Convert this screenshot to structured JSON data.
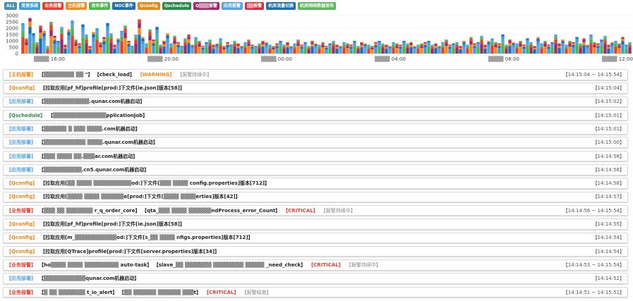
{
  "filters": [
    {
      "label": "ALL",
      "color": "#4a8fb5"
    },
    {
      "label": "变更系统",
      "color": "#3a9ee0"
    },
    {
      "label": "业务报警",
      "color": "#e8402f"
    },
    {
      "label": "主机报警",
      "color": "#f28b1e"
    },
    {
      "label": "发布事件",
      "color": "#4cb84c"
    },
    {
      "label": "NOC事件",
      "color": "#1d6fb5"
    },
    {
      "label": "Qconfig",
      "color": "#e58a16"
    },
    {
      "label": "Qschedule",
      "color": "#2e8a4a"
    },
    {
      "label": "Q▒▒▒报警",
      "color": "#9e2a6a"
    },
    {
      "label": "应用报警",
      "color": "#58a4e0"
    },
    {
      "label": "▒▒报警",
      "color": "#d62e3a"
    },
    {
      "label": "机房流量切换",
      "color": "#1f6db0"
    },
    {
      "label": "机房网络数据发布",
      "color": "#5cb85c"
    }
  ],
  "chart_data": {
    "type": "bar",
    "stacked": true,
    "yticks": [
      "3000",
      "2500",
      "2000",
      "1500",
      "1000",
      "500",
      "0"
    ],
    "ylim": [
      0,
      3000
    ],
    "xticks": [
      "▒▒▒▒ 16:00",
      "▒▒▒▒ 20:00",
      "▒▒▒▒ 00:00",
      "▒▒▒▒ 04:00",
      "▒▒▒▒ 08:00",
      "▒▒▒▒ 12:00"
    ],
    "colors": [
      "#e8402f",
      "#f28b1e",
      "#3a9ee0",
      "#4cb84c",
      "#9e2a6a",
      "#1d6fb5",
      "#58a4e0"
    ],
    "series_totals": [
      2400,
      1200,
      2800,
      1600,
      900,
      2200,
      1800,
      600,
      2500,
      1400,
      1000,
      2100,
      700,
      1900,
      2600,
      1100,
      800,
      2300,
      1500,
      600,
      1700,
      2000,
      900,
      1300,
      2400,
      1600,
      700,
      1200,
      1800,
      2200,
      1000,
      600,
      1500,
      2700,
      1300,
      800,
      1900,
      1100,
      2100,
      700,
      1000,
      1600,
      800,
      1400,
      900,
      600,
      1200,
      1500,
      700,
      1300,
      1000,
      600,
      900,
      1100,
      700,
      800,
      1200,
      600,
      900,
      700,
      1000,
      800,
      600,
      900,
      1100,
      700,
      600,
      800,
      1000,
      900,
      700,
      600,
      800,
      1000,
      700,
      900,
      600,
      800,
      1100,
      700,
      900,
      600,
      1000,
      800,
      700,
      900,
      600,
      800,
      1000,
      700,
      600,
      900,
      800,
      700,
      1000,
      600,
      900,
      800,
      700,
      600,
      900,
      1000,
      800,
      700,
      600,
      900,
      800,
      700,
      1000,
      800,
      900,
      600,
      700,
      800,
      900,
      1000,
      700,
      800,
      600,
      900,
      1100,
      700,
      800,
      900,
      600,
      1000,
      700,
      1300,
      800,
      900,
      1400,
      700,
      1000,
      1200,
      900,
      800,
      1500,
      700,
      1100,
      900,
      800,
      1000,
      700,
      1200,
      900,
      600,
      1300,
      800,
      1000,
      700,
      900,
      1500,
      800,
      1100,
      700,
      1000,
      900,
      1300,
      800,
      1200,
      700,
      1500,
      900,
      800,
      1100,
      1400,
      700,
      900,
      1000,
      800,
      1300,
      700,
      900
    ]
  },
  "rows": [
    {
      "type": "【主机报警】",
      "type_color": "#f28b1e",
      "msg": "【▒▒▒▒▒▒▒▒ ▒▒ \"】 【check_load】",
      "sev": "【WARNING】",
      "sev_color": "#f28b1e",
      "status": "【报警持续中】",
      "time": "【14:15:04 ~ 14:15:54】"
    },
    {
      "type": "【Qconfig】",
      "type_color": "#e58a16",
      "msg": "【拉取应用[pf_hf]profile[prod:]下文件[ie.json]版本[58]】",
      "sev": "",
      "sev_color": "",
      "status": "",
      "time": "【14:15:04】"
    },
    {
      "type": "【应用部署】",
      "type_color": "#58a4e0",
      "msg": "【▒▒▒▒▒▒▒▒▒▒▒▒.qunar.com机器启动】",
      "sev": "",
      "sev_color": "",
      "status": "",
      "time": "【14:15:02】"
    },
    {
      "type": "【Qschedule】",
      "type_color": "#2e8a4a",
      "msg": "【▒▒▒▒▒▒▒▒▒▒▒▒▒▒pplicationJob】",
      "sev": "",
      "sev_color": "",
      "status": "",
      "time": "【14:15:01】"
    },
    {
      "type": "【应用部署】",
      "type_color": "#58a4e0",
      "msg": "【▒▒▒▒▒▒ ▒ ▒▒▒ ▒▒▒▒.com机器启动】",
      "sev": "",
      "sev_color": "",
      "status": "",
      "time": "【14:15:01】"
    },
    {
      "type": "【应用部署】",
      "type_color": "#58a4e0",
      "msg": "【▒▒▒▒▒▒▒▒▒▒▒ ▒▒▒▒.qunar.com机器启动】",
      "sev": "",
      "sev_color": "",
      "status": "",
      "time": "【14:15:00】"
    },
    {
      "type": "【应用部署】",
      "type_color": "#58a4e0",
      "msg": "【▒▒▒ ▒▒▒▒ ▒▒.▒▒▒ar.com机器启动】",
      "sev": "",
      "sev_color": "",
      "status": "",
      "time": "【14:14:58】"
    },
    {
      "type": "【应用部署】",
      "type_color": "#58a4e0",
      "msg": "【▒▒▒▒▒▒▒▒▒▒.cn5.qunar.com机器启动】",
      "sev": "",
      "sev_color": "",
      "status": "",
      "time": "【14:14:58】"
    },
    {
      "type": "【Qconfig】",
      "type_color": "#e58a16",
      "msg": "【拉取应用[▒▒ ▒▒▒▒ ▒▒▒▒▒▒▒▒▒▒od:]下文件[▒▒▒ ▒▒▒▒ config.properties]版本[712]】",
      "sev": "",
      "sev_color": "",
      "status": "",
      "time": "【14:14:58】"
    },
    {
      "type": "【Qconfig】",
      "type_color": "#e58a16",
      "msg": "【拉取应用[▒▒▒▒ ▒▒▒▒ ▒▒▒▒▒▒e[prod:]下文件[▒▒▒▒ ▒▒▒▒erties]版本[42]】",
      "sev": "",
      "sev_color": "",
      "status": "",
      "time": "【14:14:57】"
    },
    {
      "type": "【业务报警】",
      "type_color": "#e8402f",
      "msg": "【▒▒▒ ▒▒ ▒▒▒▒▒▒▒ r_q_order_core】 【qta_▒▒▒ ▒▒▒▒ ▒▒▒▒▒▒ndProcess_error_Count】",
      "sev": "【CRITICAL】",
      "sev_color": "#e8402f",
      "status": "【报警持续中】",
      "time": "【14:14:56 ~ 14:15:54】"
    },
    {
      "type": "【Qconfig】",
      "type_color": "#e58a16",
      "msg": "【拉取应用[pf_hf]profile[prod:]下文件[ie.json]版本[58]】",
      "sev": "",
      "sev_color": "",
      "status": "",
      "time": "【14:14:55】"
    },
    {
      "type": "【Qconfig】",
      "type_color": "#e58a16",
      "msg": "【拉取应用[m_▒▒▒▒▒▒▒▒▒▒▒od:]下文件[s_▒▒ ▒▒▒▒ nfigs.properties]版本[712]】",
      "sev": "",
      "sev_color": "",
      "status": "",
      "time": "【14:14:54】"
    },
    {
      "type": "【Qconfig】",
      "type_color": "#e58a16",
      "msg": "【拉取应用[QTrace]profile[prod:]下文件[server.properties]版本[34]】",
      "sev": "",
      "sev_color": "",
      "status": "",
      "time": "【14:14:54】"
    },
    {
      "type": "【业务报警】",
      "type_color": "#e8402f",
      "msg": "【ho▒▒▒▒ ▒▒▒▒ ▒▒▒▒▒▒▒▒▒ auto-task】 【slave_▒▒ ▒▒▒▒▒▒▒ ▒▒▒▒▒▒▒▒ ▒▒▒▒▒ _need_check】",
      "sev": "【CRITICAL】",
      "sev_color": "#e8402f",
      "status": "【报警持续中】",
      "time": "【14:14:53 ~ 14:15:54】"
    },
    {
      "type": "【应用部署】",
      "type_color": "#58a4e0",
      "msg": "【▒▒▒▒▒▒▒▒▒▒▒qunar.com机器启动】",
      "sev": "",
      "sev_color": "",
      "status": "",
      "time": "【14:14:52】"
    },
    {
      "type": "【业务报警】",
      "type_color": "#e8402f",
      "msg": "【▒ ▒▒ ▒▒▒▒▒▒▒ t_io_alert】 【▒▒ ▒▒▒▒▒▒ ▒▒▒▒▒▒ ▒▒▒t】",
      "sev": "【CRITICAL】",
      "sev_color": "#e8402f",
      "status": "【报警结束】",
      "time": "【14:14:51 ~ 14:15:51】"
    }
  ]
}
